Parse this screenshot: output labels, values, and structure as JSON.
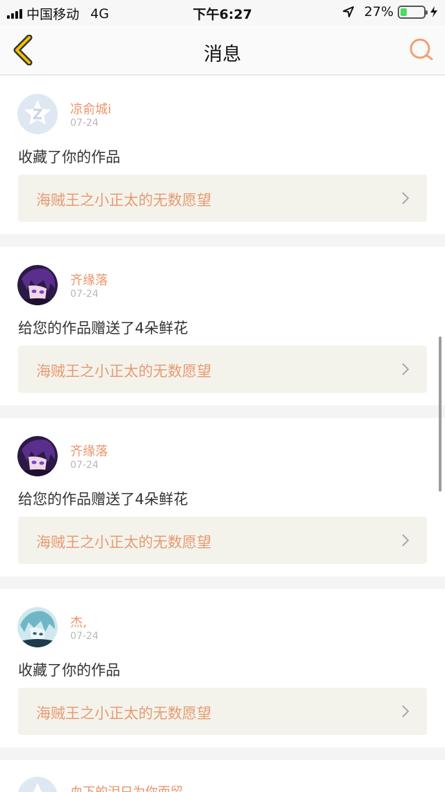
{
  "status_bar": {
    "carrier": "中国移动",
    "network": "4G",
    "time": "下午6:27",
    "battery_percent": "27%",
    "battery_level": 0.27
  },
  "nav": {
    "title": "消息",
    "back_icon": "chevron-left-icon",
    "search_icon": "search-icon"
  },
  "messages": [
    {
      "username": "凉俞城i",
      "date": "07-24",
      "action": "收藏了你的作品",
      "work_title": "海贼王之小正太的无数愿望",
      "avatar": "default-avatar"
    },
    {
      "username": "齐缘落",
      "date": "07-24",
      "action": "给您的作品赠送了4朵鲜花",
      "work_title": "海贼王之小正太的无数愿望",
      "avatar": "anime-avatar-purple"
    },
    {
      "username": "齐缘落",
      "date": "07-24",
      "action": "给您的作品赠送了4朵鲜花",
      "work_title": "海贼王之小正太的无数愿望",
      "avatar": "anime-avatar-purple"
    },
    {
      "username": "杰,",
      "date": "07-24",
      "action": "收藏了你的作品",
      "work_title": "海贼王之小正太的无数愿望",
      "avatar": "anime-avatar-teal"
    },
    {
      "username": "血下的泪只为你而留",
      "avatar": "default-avatar"
    }
  ],
  "colors": {
    "accent": "#f0a070",
    "username": "#e9946a",
    "work_title": "#e89a70",
    "battery": "#4cd964"
  }
}
